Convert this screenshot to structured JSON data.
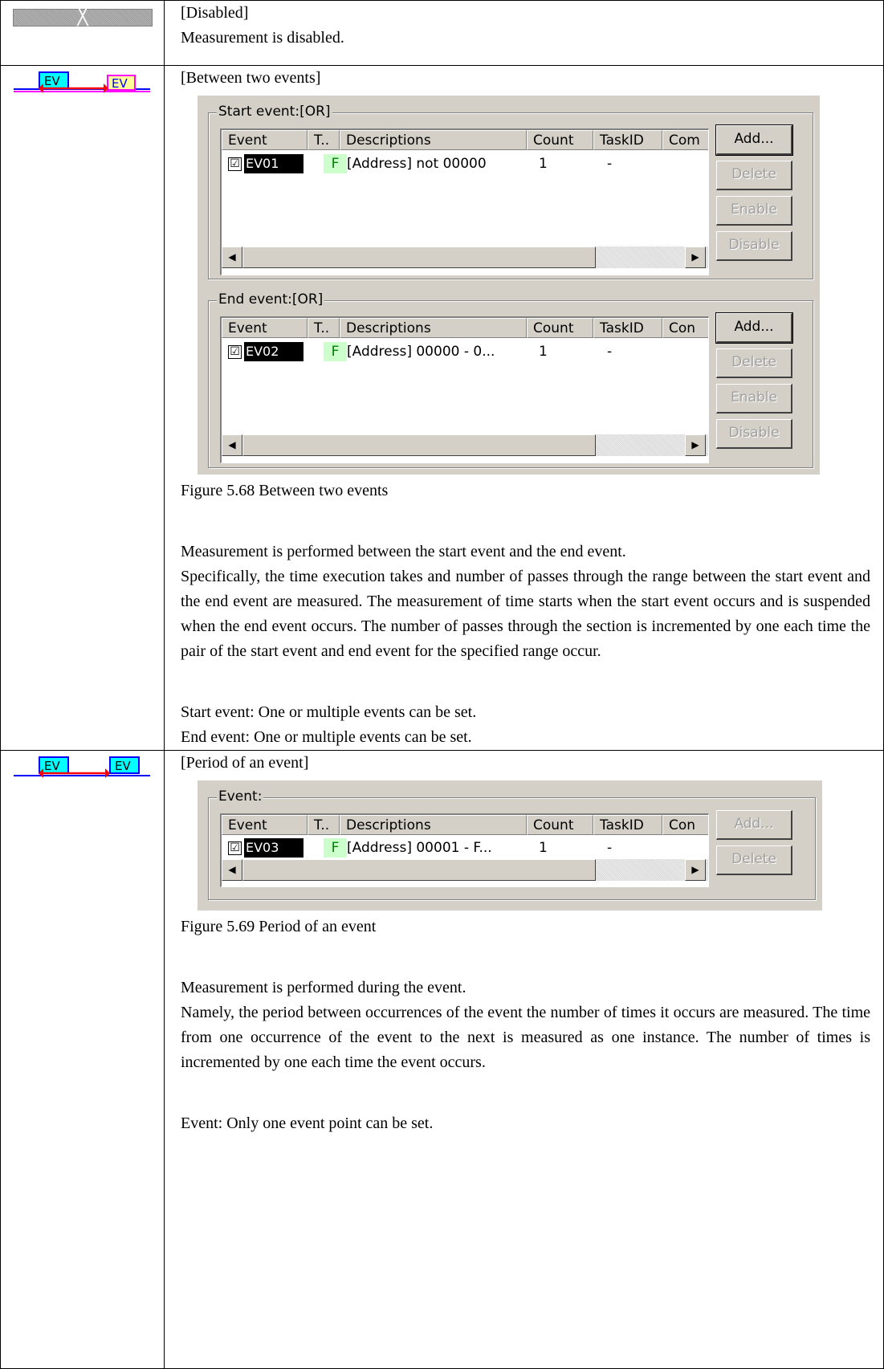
{
  "rows": [
    {
      "icon": "disabled-icon",
      "heading": "[Disabled]",
      "text": "Measurement is disabled."
    },
    {
      "icon": "between-two-events-icon",
      "icon_label_1": "EV",
      "icon_label_2": "EV",
      "heading": "[Between two events]",
      "dialog": {
        "start_group": {
          "title": "Start event:[OR]",
          "columns": [
            "Event",
            "T..",
            "Descriptions",
            "Count",
            "TaskID",
            "Com"
          ],
          "rows": [
            {
              "checked": "☑",
              "event": "EV01",
              "type": "F",
              "description": "[Address] not 00000",
              "count": "1",
              "taskid": "-"
            }
          ],
          "buttons": [
            "Add...",
            "Delete",
            "Enable",
            "Disable"
          ]
        },
        "end_group": {
          "title": "End event:[OR]",
          "columns": [
            "Event",
            "T..",
            "Descriptions",
            "Count",
            "TaskID",
            "Con"
          ],
          "rows": [
            {
              "checked": "☑",
              "event": "EV02",
              "type": "F",
              "description": "[Address] 00000 - 0...",
              "count": "1",
              "taskid": "-"
            }
          ],
          "buttons": [
            "Add...",
            "Delete",
            "Enable",
            "Disable"
          ]
        }
      },
      "caption": "Figure 5.68 Between two events",
      "p1": "Measurement is performed between the start event and the end event.",
      "p2": "Specifically, the time execution takes and number of passes through the range between the start event and the end event are measured. The measurement of time starts when the start event occurs and is suspended when the end event occurs. The number of passes through the section is incremented by one each time the pair of the start event and end event for the specified range occur.",
      "note1": "Start event: One or multiple events can be set.",
      "note2": "End event: One or multiple events can be set."
    },
    {
      "icon": "period-of-event-icon",
      "icon_label_1": "EV",
      "icon_label_2": "EV",
      "heading": "[Period of an event]",
      "dialog": {
        "group": {
          "title": "Event:",
          "columns": [
            "Event",
            "T..",
            "Descriptions",
            "Count",
            "TaskID",
            "Con"
          ],
          "rows": [
            {
              "checked": "☑",
              "event": "EV03",
              "type": "F",
              "description": "[Address] 00001 - F...",
              "count": "1",
              "taskid": "-"
            }
          ],
          "buttons": [
            "Add...",
            "Delete"
          ]
        }
      },
      "caption": "Figure 5.69 Period of an event",
      "p1": "Measurement is performed during the event.",
      "p2": "Namely, the period between occurrences of the event the number of times it occurs are measured. The time from one occurrence of the event to the next is measured as one instance. The number of times is incremented by one each time the event occurs.",
      "note1": "Event: Only one event point can be set."
    }
  ],
  "colors": {
    "event_box_cyan": "#00ffff",
    "event_box_yellow": "#ffff99",
    "event_label_blue": "#0000ff",
    "arrow_red": "#ff0000",
    "line_magenta": "#ff00ff",
    "line_blue": "#0000ff",
    "dialog_bg": "#d4d0c8"
  }
}
